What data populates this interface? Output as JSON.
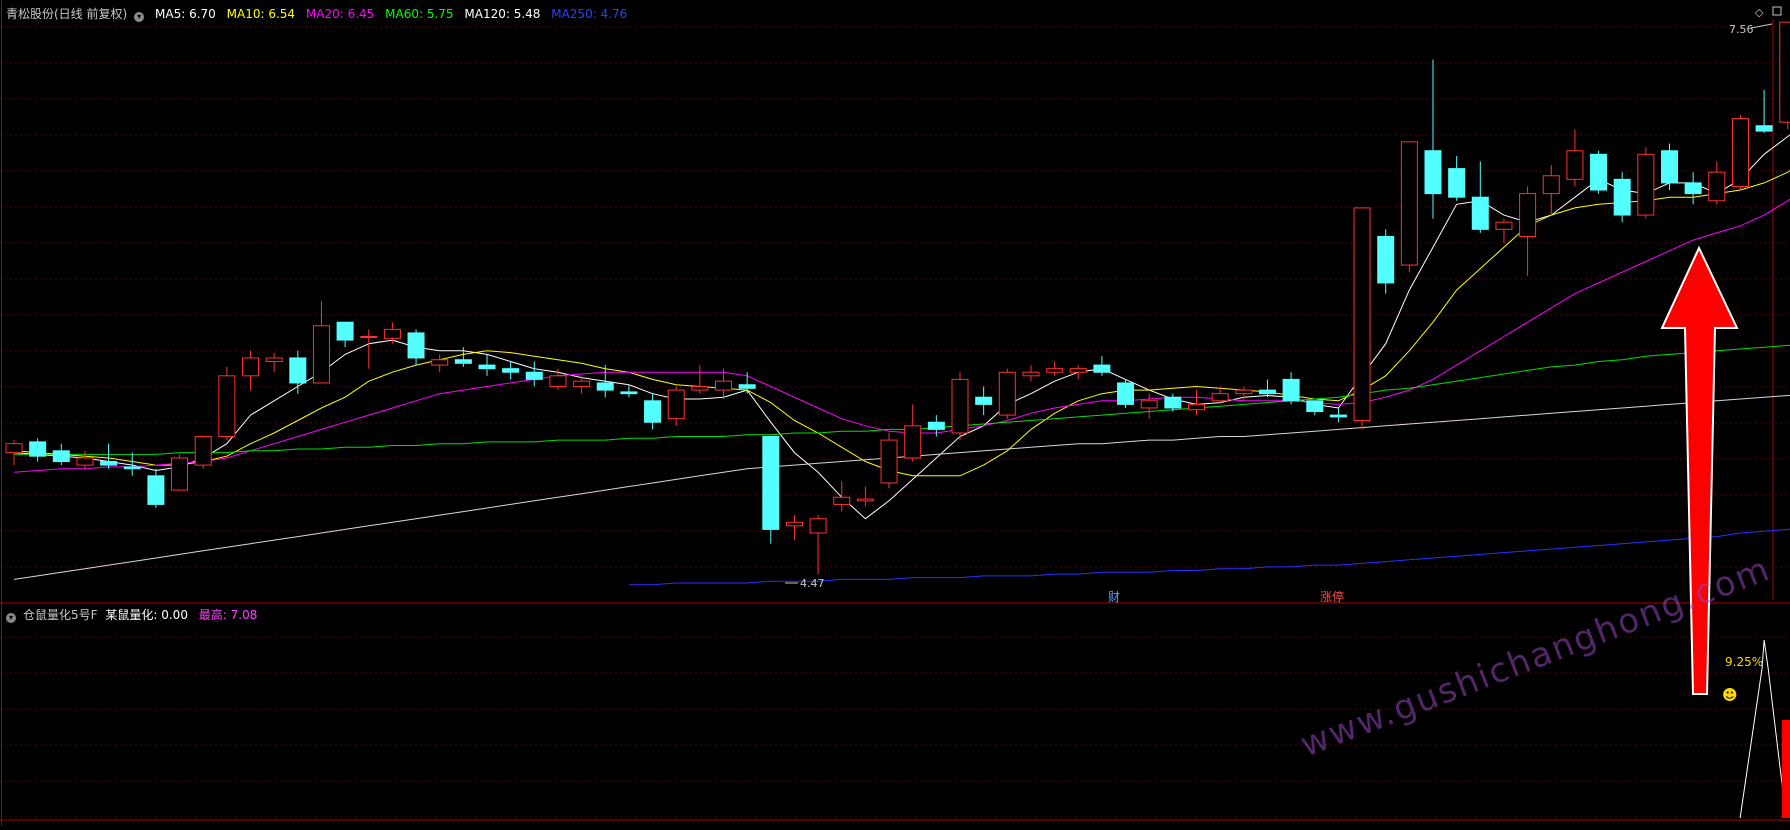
{
  "header": {
    "title": "青松股份(日线 前复权)",
    "ma": [
      {
        "label": "MA5: 6.70",
        "color": "#ffffff"
      },
      {
        "label": "MA10: 6.54",
        "color": "#ffff00"
      },
      {
        "label": "MA20: 6.45",
        "color": "#ff00ff"
      },
      {
        "label": "MA60: 5.75",
        "color": "#00ff00"
      },
      {
        "label": "MA120: 5.48",
        "color": "#ffffff"
      },
      {
        "label": "MA250: 4.76",
        "color": "#0000ff"
      }
    ]
  },
  "subheader": {
    "title": "仓鼠量化5号F",
    "value_label": "某鼠量化: 0.00",
    "max_label": "最高: 7.08"
  },
  "annotations": {
    "high": "7.56",
    "low": "4.47",
    "cai": "财",
    "zhangting": "涨停",
    "percent": "9.25%",
    "smiley": "☻"
  },
  "watermark": "www.gushichanghong.com",
  "colors": {
    "up": "#ff3030",
    "down": "#54ffff",
    "grid": "#5a0000",
    "frame": "#b00000",
    "arrow": "#ff0000"
  },
  "chart_data": {
    "type": "candlestick",
    "title": "青松股份(日线 前复权)",
    "candles": [
      {
        "o": 5.15,
        "h": 5.22,
        "l": 5.08,
        "c": 5.2
      },
      {
        "o": 5.21,
        "h": 5.23,
        "l": 5.1,
        "c": 5.13
      },
      {
        "o": 5.16,
        "h": 5.2,
        "l": 5.08,
        "c": 5.1
      },
      {
        "o": 5.08,
        "h": 5.16,
        "l": 5.05,
        "c": 5.12
      },
      {
        "o": 5.1,
        "h": 5.2,
        "l": 5.06,
        "c": 5.08
      },
      {
        "o": 5.07,
        "h": 5.15,
        "l": 5.02,
        "c": 5.06
      },
      {
        "o": 5.02,
        "h": 5.06,
        "l": 4.84,
        "c": 4.86
      },
      {
        "o": 4.94,
        "h": 5.14,
        "l": 4.94,
        "c": 5.12
      },
      {
        "o": 5.08,
        "h": 5.24,
        "l": 5.06,
        "c": 5.24
      },
      {
        "o": 5.24,
        "h": 5.63,
        "l": 5.22,
        "c": 5.58
      },
      {
        "o": 5.58,
        "h": 5.72,
        "l": 5.5,
        "c": 5.68
      },
      {
        "o": 5.66,
        "h": 5.71,
        "l": 5.6,
        "c": 5.68
      },
      {
        "o": 5.68,
        "h": 5.72,
        "l": 5.48,
        "c": 5.54
      },
      {
        "o": 5.54,
        "h": 6.0,
        "l": 5.54,
        "c": 5.86
      },
      {
        "o": 5.88,
        "h": 5.88,
        "l": 5.74,
        "c": 5.78
      },
      {
        "o": 5.8,
        "h": 5.84,
        "l": 5.62,
        "c": 5.8
      },
      {
        "o": 5.79,
        "h": 5.88,
        "l": 5.76,
        "c": 5.84
      },
      {
        "o": 5.82,
        "h": 5.84,
        "l": 5.64,
        "c": 5.68
      },
      {
        "o": 5.64,
        "h": 5.7,
        "l": 5.6,
        "c": 5.67
      },
      {
        "o": 5.67,
        "h": 5.74,
        "l": 5.63,
        "c": 5.65
      },
      {
        "o": 5.64,
        "h": 5.7,
        "l": 5.58,
        "c": 5.62
      },
      {
        "o": 5.62,
        "h": 5.66,
        "l": 5.56,
        "c": 5.6
      },
      {
        "o": 5.6,
        "h": 5.66,
        "l": 5.52,
        "c": 5.56
      },
      {
        "o": 5.52,
        "h": 5.62,
        "l": 5.5,
        "c": 5.58
      },
      {
        "o": 5.52,
        "h": 5.58,
        "l": 5.48,
        "c": 5.55
      },
      {
        "o": 5.54,
        "h": 5.64,
        "l": 5.46,
        "c": 5.5
      },
      {
        "o": 5.49,
        "h": 5.53,
        "l": 5.46,
        "c": 5.48
      },
      {
        "o": 5.44,
        "h": 5.48,
        "l": 5.28,
        "c": 5.32
      },
      {
        "o": 5.34,
        "h": 5.52,
        "l": 5.3,
        "c": 5.5
      },
      {
        "o": 5.5,
        "h": 5.64,
        "l": 5.48,
        "c": 5.52
      },
      {
        "o": 5.5,
        "h": 5.62,
        "l": 5.45,
        "c": 5.55
      },
      {
        "o": 5.53,
        "h": 5.6,
        "l": 5.48,
        "c": 5.51
      },
      {
        "o": 5.24,
        "h": 5.24,
        "l": 4.64,
        "c": 4.72
      },
      {
        "o": 4.74,
        "h": 4.8,
        "l": 4.66,
        "c": 4.76
      },
      {
        "o": 4.7,
        "h": 4.8,
        "l": 4.47,
        "c": 4.78
      },
      {
        "o": 4.86,
        "h": 4.99,
        "l": 4.82,
        "c": 4.9
      },
      {
        "o": 4.88,
        "h": 4.96,
        "l": 4.85,
        "c": 4.89
      },
      {
        "o": 4.98,
        "h": 5.26,
        "l": 4.95,
        "c": 5.22
      },
      {
        "o": 5.12,
        "h": 5.42,
        "l": 5.1,
        "c": 5.3
      },
      {
        "o": 5.32,
        "h": 5.36,
        "l": 5.24,
        "c": 5.28
      },
      {
        "o": 5.26,
        "h": 5.6,
        "l": 5.22,
        "c": 5.56
      },
      {
        "o": 5.46,
        "h": 5.52,
        "l": 5.36,
        "c": 5.42
      },
      {
        "o": 5.36,
        "h": 5.62,
        "l": 5.34,
        "c": 5.6
      },
      {
        "o": 5.58,
        "h": 5.64,
        "l": 5.55,
        "c": 5.6
      },
      {
        "o": 5.6,
        "h": 5.66,
        "l": 5.58,
        "c": 5.62
      },
      {
        "o": 5.6,
        "h": 5.64,
        "l": 5.56,
        "c": 5.62
      },
      {
        "o": 5.64,
        "h": 5.69,
        "l": 5.58,
        "c": 5.6
      },
      {
        "o": 5.54,
        "h": 5.56,
        "l": 5.4,
        "c": 5.42
      },
      {
        "o": 5.4,
        "h": 5.48,
        "l": 5.34,
        "c": 5.44
      },
      {
        "o": 5.46,
        "h": 5.48,
        "l": 5.38,
        "c": 5.4
      },
      {
        "o": 5.39,
        "h": 5.5,
        "l": 5.36,
        "c": 5.42
      },
      {
        "o": 5.44,
        "h": 5.52,
        "l": 5.42,
        "c": 5.48
      },
      {
        "o": 5.48,
        "h": 5.52,
        "l": 5.44,
        "c": 5.5
      },
      {
        "o": 5.5,
        "h": 5.56,
        "l": 5.46,
        "c": 5.48
      },
      {
        "o": 5.56,
        "h": 5.6,
        "l": 5.42,
        "c": 5.44
      },
      {
        "o": 5.44,
        "h": 5.44,
        "l": 5.36,
        "c": 5.38
      },
      {
        "o": 5.36,
        "h": 5.4,
        "l": 5.32,
        "c": 5.35
      },
      {
        "o": 5.33,
        "h": 6.52,
        "l": 5.28,
        "c": 6.52
      },
      {
        "o": 6.36,
        "h": 6.4,
        "l": 6.04,
        "c": 6.1
      },
      {
        "o": 6.2,
        "h": 6.89,
        "l": 6.16,
        "c": 6.89
      },
      {
        "o": 6.84,
        "h": 7.35,
        "l": 6.46,
        "c": 6.6
      },
      {
        "o": 6.74,
        "h": 6.81,
        "l": 6.56,
        "c": 6.58
      },
      {
        "o": 6.58,
        "h": 6.78,
        "l": 6.38,
        "c": 6.4
      },
      {
        "o": 6.4,
        "h": 6.46,
        "l": 6.32,
        "c": 6.44
      },
      {
        "o": 6.36,
        "h": 6.64,
        "l": 6.14,
        "c": 6.6
      },
      {
        "o": 6.6,
        "h": 6.76,
        "l": 6.48,
        "c": 6.7
      },
      {
        "o": 6.68,
        "h": 6.96,
        "l": 6.64,
        "c": 6.84
      },
      {
        "o": 6.82,
        "h": 6.84,
        "l": 6.6,
        "c": 6.62
      },
      {
        "o": 6.68,
        "h": 6.72,
        "l": 6.44,
        "c": 6.48
      },
      {
        "o": 6.48,
        "h": 6.86,
        "l": 6.46,
        "c": 6.82
      },
      {
        "o": 6.84,
        "h": 6.88,
        "l": 6.62,
        "c": 6.66
      },
      {
        "o": 6.66,
        "h": 6.72,
        "l": 6.54,
        "c": 6.6
      },
      {
        "o": 6.56,
        "h": 6.78,
        "l": 6.54,
        "c": 6.72
      },
      {
        "o": 6.64,
        "h": 7.04,
        "l": 6.62,
        "c": 7.02
      },
      {
        "o": 6.98,
        "h": 7.18,
        "l": 6.94,
        "c": 6.95
      },
      {
        "o": 7.0,
        "h": 7.56,
        "l": 6.96,
        "c": 7.56
      }
    ],
    "lows_label": "4.47",
    "highs_label": "7.56",
    "moving_averages": [
      {
        "name": "MA5",
        "values": [
          5.15,
          5.14,
          5.13,
          5.12,
          5.1,
          5.08,
          5.05,
          5.07,
          5.12,
          5.2,
          5.36,
          5.44,
          5.52,
          5.6,
          5.7,
          5.76,
          5.78,
          5.74,
          5.72,
          5.72,
          5.7,
          5.66,
          5.62,
          5.6,
          5.57,
          5.55,
          5.53,
          5.48,
          5.45,
          5.45,
          5.46,
          5.5,
          5.32,
          5.15,
          5.04,
          4.9,
          4.78,
          4.88,
          5.0,
          5.12,
          5.24,
          5.3,
          5.42,
          5.48,
          5.55,
          5.6,
          5.62,
          5.56,
          5.5,
          5.45,
          5.42,
          5.43,
          5.46,
          5.47,
          5.46,
          5.42,
          5.4,
          5.58,
          5.76,
          6.06,
          6.3,
          6.54,
          6.56,
          6.48,
          6.44,
          6.48,
          6.58,
          6.68,
          6.62,
          6.6,
          6.66,
          6.66,
          6.6,
          6.68,
          6.82,
          6.92,
          7.02
        ]
      },
      {
        "name": "MA10",
        "values": [
          5.16,
          5.15,
          5.14,
          5.13,
          5.12,
          5.1,
          5.08,
          5.08,
          5.1,
          5.13,
          5.2,
          5.26,
          5.33,
          5.4,
          5.46,
          5.55,
          5.6,
          5.64,
          5.67,
          5.7,
          5.72,
          5.71,
          5.69,
          5.67,
          5.65,
          5.62,
          5.6,
          5.56,
          5.53,
          5.52,
          5.51,
          5.5,
          5.43,
          5.33,
          5.26,
          5.18,
          5.1,
          5.05,
          5.02,
          5.02,
          5.02,
          5.08,
          5.16,
          5.28,
          5.37,
          5.44,
          5.48,
          5.5,
          5.5,
          5.51,
          5.52,
          5.51,
          5.5,
          5.49,
          5.47,
          5.45,
          5.44,
          5.5,
          5.58,
          5.72,
          5.88,
          6.06,
          6.18,
          6.3,
          6.42,
          6.48,
          6.52,
          6.54,
          6.55,
          6.56,
          6.58,
          6.58,
          6.6,
          6.62,
          6.66,
          6.72,
          6.82
        ]
      },
      {
        "name": "MA20",
        "values": [
          5.04,
          5.05,
          5.06,
          5.06,
          5.07,
          5.07,
          5.08,
          5.09,
          5.1,
          5.12,
          5.16,
          5.2,
          5.24,
          5.28,
          5.32,
          5.36,
          5.4,
          5.44,
          5.48,
          5.5,
          5.52,
          5.54,
          5.56,
          5.58,
          5.59,
          5.6,
          5.6,
          5.6,
          5.6,
          5.6,
          5.6,
          5.58,
          5.52,
          5.46,
          5.4,
          5.34,
          5.3,
          5.27,
          5.26,
          5.26,
          5.28,
          5.3,
          5.33,
          5.37,
          5.4,
          5.42,
          5.44,
          5.44,
          5.45,
          5.46,
          5.46,
          5.45,
          5.44,
          5.44,
          5.44,
          5.43,
          5.42,
          5.43,
          5.46,
          5.5,
          5.56,
          5.64,
          5.72,
          5.8,
          5.88,
          5.96,
          6.04,
          6.1,
          6.16,
          6.22,
          6.28,
          6.34,
          6.38,
          6.42,
          6.48,
          6.56,
          6.66
        ]
      },
      {
        "name": "MA60",
        "values": [
          5.14,
          5.14,
          5.14,
          5.14,
          5.14,
          5.14,
          5.14,
          5.15,
          5.15,
          5.15,
          5.16,
          5.16,
          5.17,
          5.17,
          5.18,
          5.18,
          5.19,
          5.19,
          5.2,
          5.2,
          5.21,
          5.21,
          5.21,
          5.22,
          5.22,
          5.22,
          5.23,
          5.23,
          5.24,
          5.24,
          5.24,
          5.25,
          5.25,
          5.26,
          5.26,
          5.27,
          5.27,
          5.28,
          5.28,
          5.29,
          5.3,
          5.31,
          5.32,
          5.33,
          5.34,
          5.35,
          5.36,
          5.37,
          5.38,
          5.39,
          5.4,
          5.41,
          5.42,
          5.43,
          5.44,
          5.45,
          5.46,
          5.48,
          5.5,
          5.51,
          5.53,
          5.55,
          5.57,
          5.59,
          5.61,
          5.63,
          5.64,
          5.66,
          5.67,
          5.69,
          5.7,
          5.71,
          5.72,
          5.73,
          5.74,
          5.75,
          5.75
        ]
      },
      {
        "name": "MA120",
        "values": [
          4.44,
          4.46,
          4.48,
          4.5,
          4.52,
          4.54,
          4.56,
          4.58,
          4.6,
          4.62,
          4.64,
          4.66,
          4.68,
          4.7,
          4.72,
          4.74,
          4.76,
          4.78,
          4.8,
          4.82,
          4.84,
          4.86,
          4.88,
          4.9,
          4.92,
          4.94,
          4.96,
          4.98,
          5.0,
          5.02,
          5.04,
          5.06,
          5.07,
          5.08,
          5.09,
          5.1,
          5.11,
          5.12,
          5.13,
          5.14,
          5.15,
          5.16,
          5.17,
          5.18,
          5.19,
          5.2,
          5.2,
          5.21,
          5.22,
          5.22,
          5.23,
          5.24,
          5.24,
          5.25,
          5.26,
          5.27,
          5.28,
          5.29,
          5.3,
          5.31,
          5.32,
          5.33,
          5.34,
          5.35,
          5.36,
          5.37,
          5.38,
          5.39,
          5.4,
          5.41,
          5.42,
          5.43,
          5.44,
          5.45,
          5.46,
          5.47,
          5.48
        ]
      },
      {
        "name": "MA250",
        "start_index": 26,
        "values": [
          4.41,
          4.41,
          4.42,
          4.42,
          4.42,
          4.42,
          4.43,
          4.43,
          4.43,
          4.44,
          4.44,
          4.44,
          4.45,
          4.45,
          4.45,
          4.46,
          4.46,
          4.46,
          4.47,
          4.47,
          4.48,
          4.48,
          4.48,
          4.49,
          4.49,
          4.5,
          4.5,
          4.51,
          4.51,
          4.52,
          4.52,
          4.53,
          4.54,
          4.55,
          4.56,
          4.57,
          4.58,
          4.59,
          4.6,
          4.61,
          4.62,
          4.63,
          4.64,
          4.65,
          4.66,
          4.67,
          4.68,
          4.7,
          4.71,
          4.72,
          4.74
        ]
      }
    ],
    "sub_indicator": {
      "name": "某鼠量化",
      "value": 0.0,
      "max": 7.08,
      "pulse_index": 74,
      "bar_index": 75
    }
  }
}
